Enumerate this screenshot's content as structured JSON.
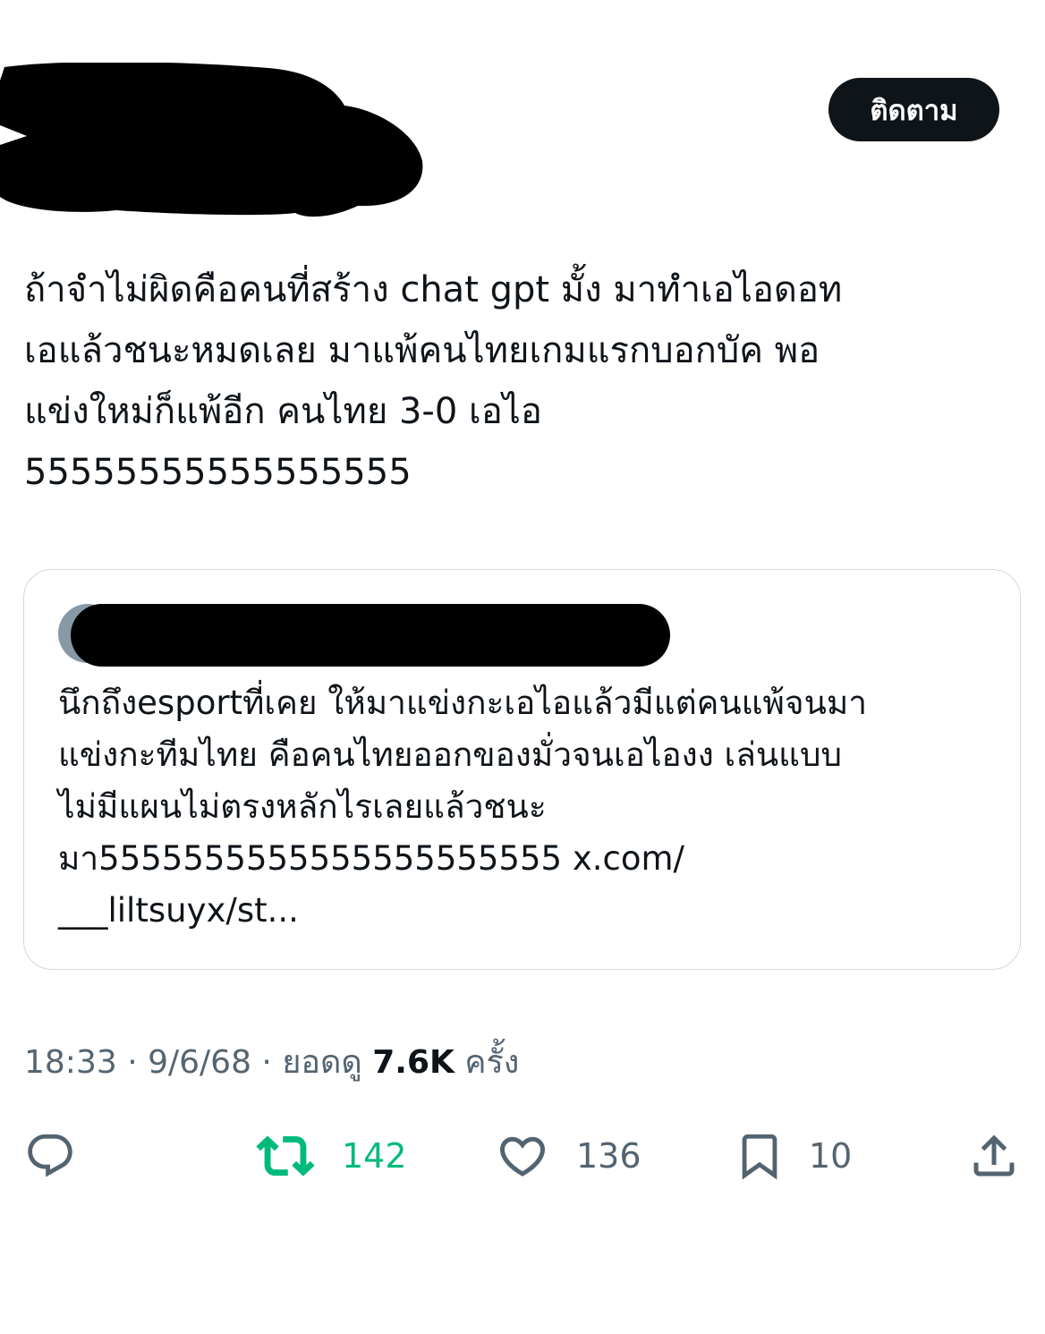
{
  "header": {
    "follow_label": "ติดตาม"
  },
  "tweet": {
    "text": "ถ้าจำไม่ผิดคือคนที่สร้าง chat gpt มั้ง มาทำเอไอดอท\nเอแล้วชนะหมดเลย มาแพ้คนไทยเกมแรกบอกบัค พอ\nแข่งใหม่ก็แพ้อีก คนไทย 3-0 เอไอ\n55555555555555555"
  },
  "quote": {
    "text": "นึกถึงesportที่เคย ให้มาแข่งกะเอไอแล้วมีแต่คนแพ้จนมา\nแข่งกะทีมไทย คือคนไทยออกของมั่วจนเอไองง เล่นแบบ\nไม่มีแผนไม่ตรงหลักไรเลยแล้วชนะ\nมา5555555555555555555555 x.com/\n___liltsuyx/st..."
  },
  "meta": {
    "time": "18:33",
    "separator": " · ",
    "date": "9/6/68",
    "views_prefix": "ยอดดู",
    "views_count": "7.6K",
    "views_suffix": "ครั้ง"
  },
  "actions": {
    "reply_icon": "reply-icon",
    "retweet_icon": "retweet-icon",
    "retweet_count": "142",
    "like_icon": "heart-icon",
    "like_count": "136",
    "bookmark_icon": "bookmark-icon",
    "bookmark_count": "10",
    "share_icon": "share-icon"
  },
  "colors": {
    "text": "#0f1419",
    "muted": "#536471",
    "retweet_active": "#00ba7c",
    "border": "#cfd9de",
    "button_bg": "#0f1419"
  }
}
